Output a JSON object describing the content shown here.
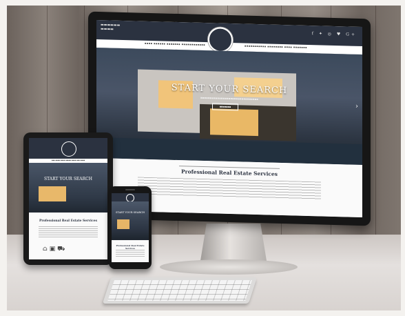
{
  "scene": {
    "colors": {
      "navy": "#2b3240",
      "window_glow": "#f1c47a",
      "wall_wood": "#8a817a",
      "desk": "#e4e0de"
    }
  },
  "monitor": {
    "hero_title": "START YOUR SEARCH",
    "section_title": "Professional Real Estate Services",
    "social_icons": "f ✦ ◎ ♥ G+",
    "next_arrow": "›"
  },
  "tablet": {
    "hero_title": "START YOUR SEARCH",
    "section_title": "Professional Real Estate Services",
    "icons": "⌂ ▣ ⛟"
  },
  "phone": {
    "hero_title": "START YOUR SEARCH",
    "section_title": "Professional Real Estate Services"
  }
}
